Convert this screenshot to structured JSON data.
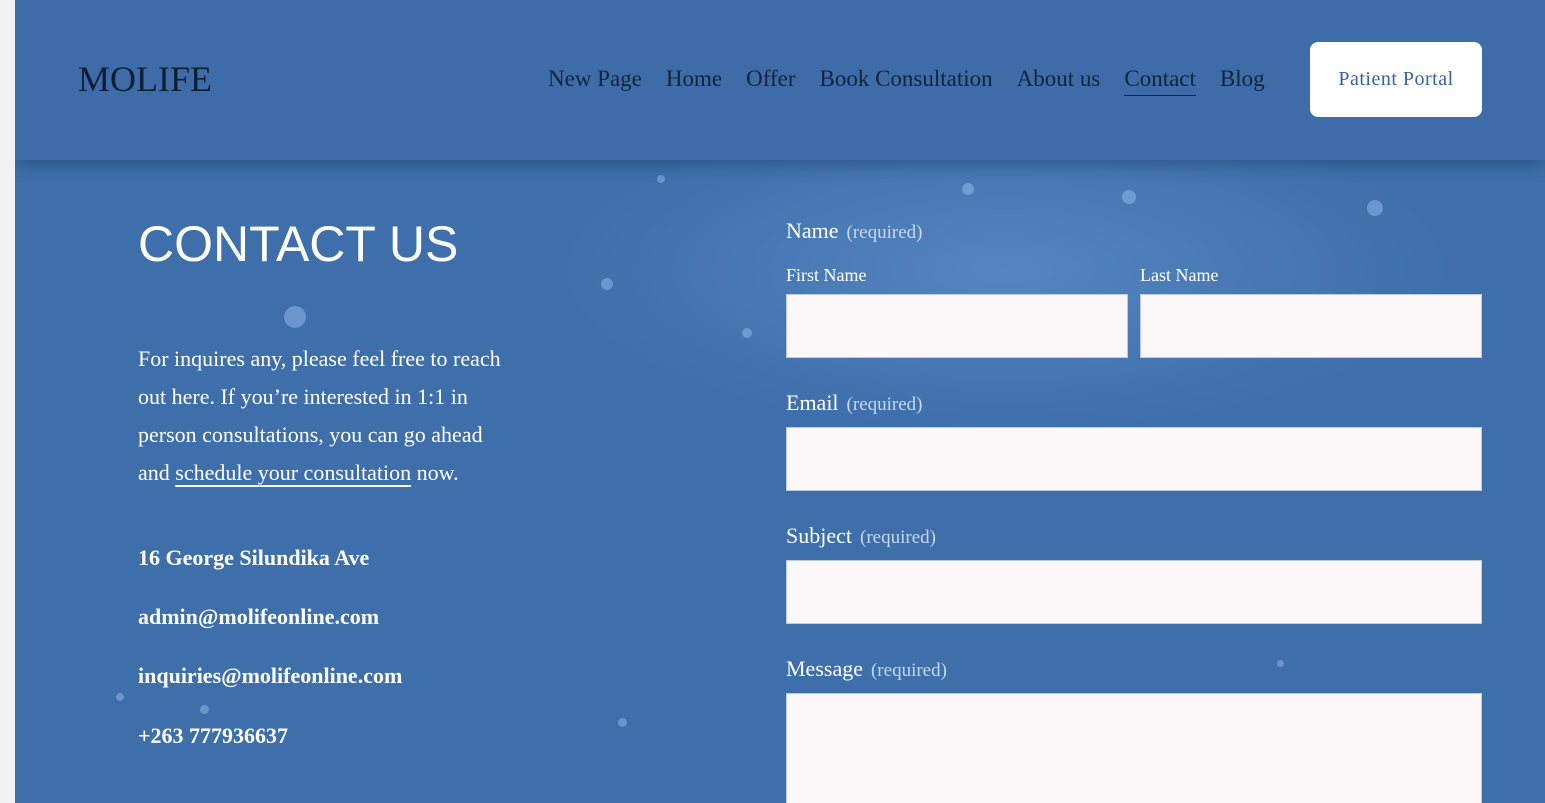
{
  "header": {
    "logo": "MOLIFE",
    "nav": [
      {
        "label": "New Page"
      },
      {
        "label": "Home"
      },
      {
        "label": "Offer"
      },
      {
        "label": "Book Consultation"
      },
      {
        "label": "About us"
      },
      {
        "label": "Contact"
      },
      {
        "label": "Blog"
      }
    ],
    "active_nav": "Contact",
    "portal_button": "Patient Portal"
  },
  "contact": {
    "title": "CONTACT US",
    "intro_before": "For inquires any, please feel free to reach out here. If you’re interested in 1:1 in person consultations, you can go ahead and ",
    "intro_link": "schedule your consultation",
    "intro_after": " now.",
    "address": "16 George Silundika Ave",
    "email_admin": "admin@molifeonline.com",
    "email_inquiries": "inquiries@molifeonline.com",
    "phone": "+263 777936637"
  },
  "form": {
    "name_label": "Name",
    "required_text": "(required)",
    "first_name_label": "First Name",
    "last_name_label": "Last Name",
    "email_label": "Email",
    "subject_label": "Subject",
    "message_label": "Message",
    "first_name_value": "",
    "last_name_value": "",
    "email_value": "",
    "subject_value": "",
    "message_value": ""
  },
  "colors": {
    "background": "#3e6fab",
    "header": "#3d6ca9",
    "field": "#fcf8f9",
    "button_text": "#35649e"
  }
}
